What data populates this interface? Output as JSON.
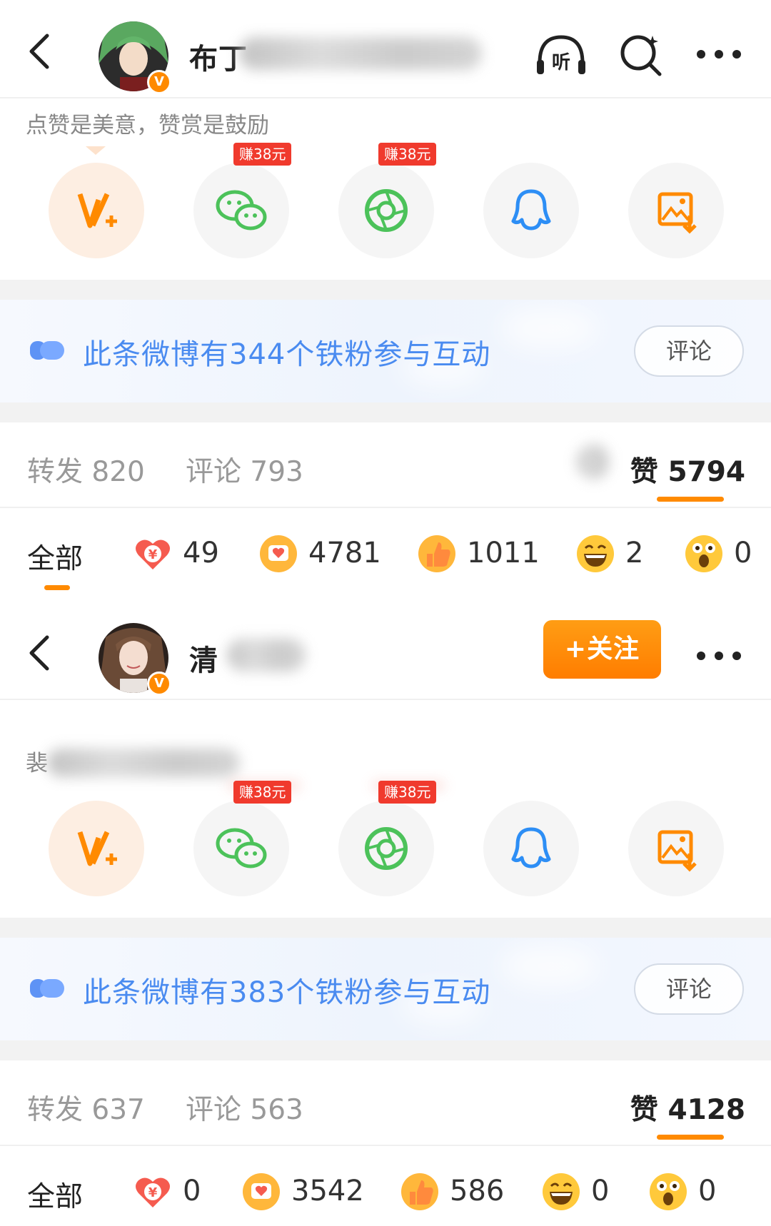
{
  "posts": [
    {
      "header": {
        "user_name_visible": "布丁",
        "listen_label": "听",
        "action": "icons"
      },
      "tip": "点赞是美意，赞赏是鼓励",
      "share": {
        "earn_tag_wechat": "赚38元",
        "earn_tag_moments": "赚38元",
        "icons": [
          "vplus-icon",
          "wechat-icon",
          "moments-icon",
          "qq-icon",
          "save-image-icon"
        ]
      },
      "fan_banner": {
        "text": "此条微博有344个铁粉参与互动",
        "button": "评论"
      },
      "counts": {
        "repost": "转发 820",
        "comment": "评论 793",
        "like_label": "赞",
        "like_value": "5794"
      },
      "reactions": {
        "all": "全部",
        "items": [
          {
            "icon": "reward-icon",
            "value": "49"
          },
          {
            "icon": "heart-bubble-icon",
            "value": "4781"
          },
          {
            "icon": "thumbs-up-icon",
            "value": "1011"
          },
          {
            "icon": "laugh-icon",
            "value": "2"
          },
          {
            "icon": "surprise-icon",
            "value": "0"
          }
        ]
      }
    },
    {
      "header": {
        "user_name_visible": "清",
        "follow_label": "+关注",
        "action": "follow"
      },
      "tip": "裴",
      "share": {
        "earn_tag_wechat": "赚38元",
        "earn_tag_moments": "赚38元",
        "icons": [
          "vplus-icon",
          "wechat-icon",
          "moments-icon",
          "qq-icon",
          "save-image-icon"
        ]
      },
      "fan_banner": {
        "text": "此条微博有383个铁粉参与互动",
        "button": "评论"
      },
      "counts": {
        "repost": "转发 637",
        "comment": "评论 563",
        "like_label": "赞",
        "like_value": "4128"
      },
      "reactions": {
        "all": "全部",
        "items": [
          {
            "icon": "reward-icon",
            "value": "0"
          },
          {
            "icon": "heart-bubble-icon",
            "value": "3542"
          },
          {
            "icon": "thumbs-up-icon",
            "value": "586"
          },
          {
            "icon": "laugh-icon",
            "value": "0"
          },
          {
            "icon": "surprise-icon",
            "value": "0"
          }
        ]
      }
    }
  ],
  "colors": {
    "accent": "#ff8a00",
    "link_blue": "#4a8bf0",
    "earn_red": "#f03a2d",
    "wechat_green": "#4cc25a"
  }
}
